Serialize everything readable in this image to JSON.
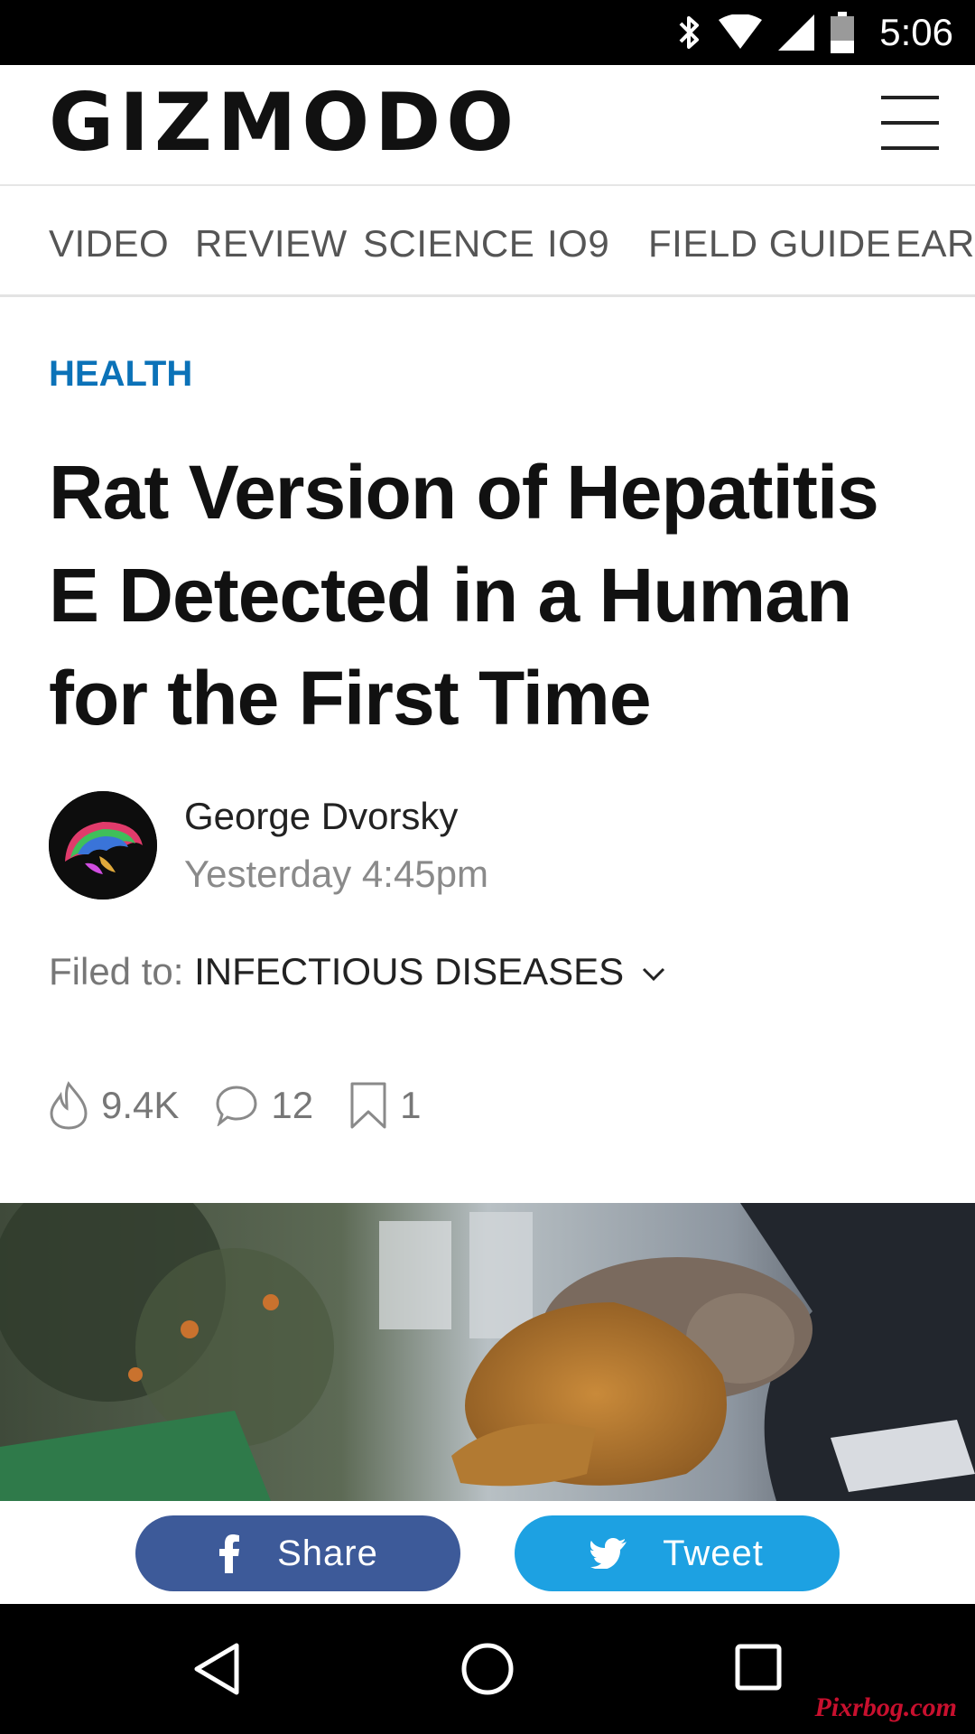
{
  "status_bar": {
    "time": "5:06",
    "icons": [
      "bluetooth-icon",
      "wifi-icon",
      "signal-icon",
      "battery-icon"
    ]
  },
  "header": {
    "logo": "GIZMODO",
    "menu_icon": "hamburger-menu-icon"
  },
  "nav": {
    "items": [
      {
        "label": "VIDEO"
      },
      {
        "label": "REVIEW"
      },
      {
        "label": "SCIENCE"
      },
      {
        "label": "IO9"
      },
      {
        "label": "FIELD GUIDE"
      },
      {
        "label": "EART"
      }
    ]
  },
  "article": {
    "category": "HEALTH",
    "headline": "Rat Version of Hepatitis E Detected in a Human for the First Time",
    "author": "George Dvorsky",
    "date": "Yesterday 4:45pm",
    "filed_label": "Filed to:",
    "filed_tag": "INFECTIOUS DISEASES",
    "stats": {
      "views": "9.4K",
      "comments": "12",
      "bookmarks": "1"
    }
  },
  "share_bar": {
    "facebook_label": "Share",
    "twitter_label": "Tweet"
  },
  "watermark": "Pixrbog.com",
  "colors": {
    "category": "#0b72b8",
    "facebook": "#3d5a99",
    "twitter": "#1da1e2"
  }
}
